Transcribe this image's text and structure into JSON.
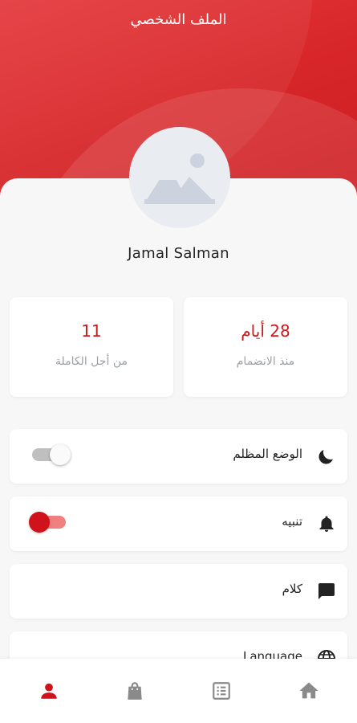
{
  "header": {
    "title": "الملف الشخصي"
  },
  "profile": {
    "name": "Jamal Salman",
    "avatar_icon": "image-placeholder-icon"
  },
  "stats": [
    {
      "value": "28 أيام",
      "label": "منذ الانضمام"
    },
    {
      "value": "11",
      "label": "من أجل الكاملة"
    }
  ],
  "settings": [
    {
      "label": "الوضع المظلم",
      "icon": "moon-icon",
      "toggle": false
    },
    {
      "label": "تنبيه",
      "icon": "bell-icon",
      "toggle": true
    },
    {
      "label": "كلام",
      "icon": "chat-icon"
    },
    {
      "label": "Language",
      "icon": "globe-icon"
    }
  ],
  "bottom_nav": [
    {
      "icon": "profile-icon",
      "active": true
    },
    {
      "icon": "shopping-bag-icon",
      "active": false
    },
    {
      "icon": "orders-list-icon",
      "active": false
    },
    {
      "icon": "home-icon",
      "active": false
    }
  ],
  "colors": {
    "accent": "#d0121a",
    "header": "#d8272a",
    "background": "#f7f7f8",
    "nav_inactive": "#8a8a8a"
  }
}
